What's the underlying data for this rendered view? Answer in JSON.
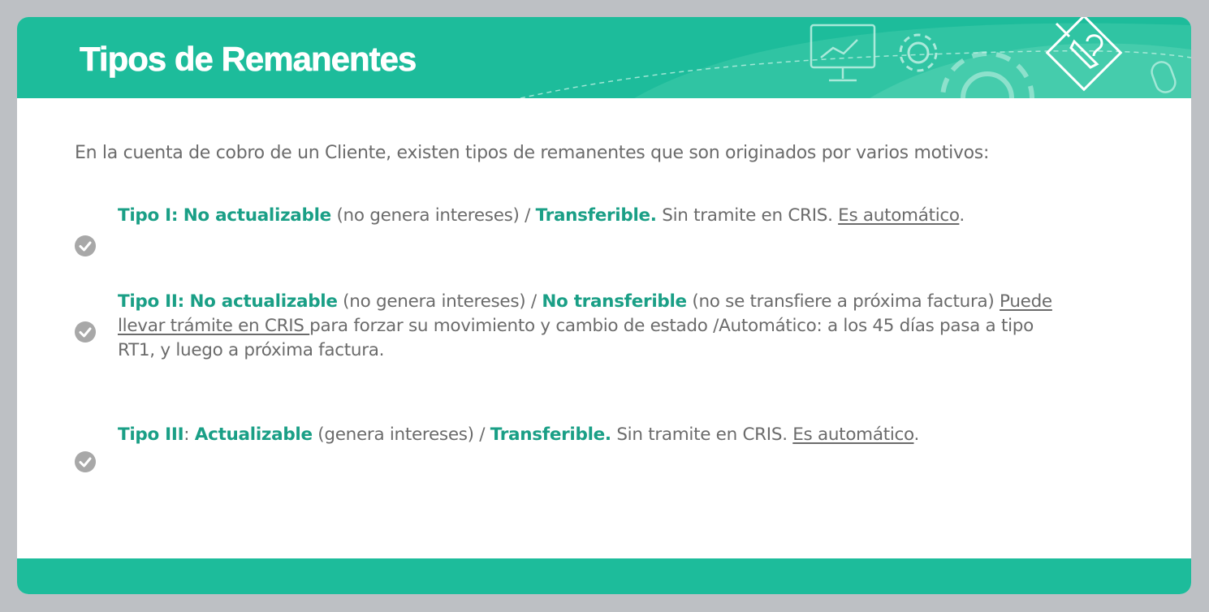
{
  "title": "Tipos de Remanentes",
  "intro": "En la cuenta de cobro de un Cliente, existen tipos de remanentes que son originados por varios motivos:",
  "colors": {
    "accent": "#1dbc9b",
    "accent_text": "#1a9f86",
    "body_text": "#6b6b6b",
    "check": "#a8a8a8"
  },
  "items": [
    {
      "icon": "check-circle-icon",
      "label": "Tipo I:",
      "status": "No actualizable",
      "note": " (no genera intereses) / ",
      "transfer": "Transferible.",
      "tail": " Sin tramite en CRIS. ",
      "underlined": "Es automático",
      "end": "."
    },
    {
      "icon": "check-circle-icon",
      "label": "Tipo II:",
      "status": "No actualizable",
      "note": " (no genera intereses) / ",
      "transfer": "No transferible",
      "note2": " (no se transfiere a próxima factura) ",
      "underlined": "Puede llevar trámite en CRIS ",
      "tail": "para forzar su movimiento y cambio de estado /Automático: a los 45 días pasa a tipo RT1, y luego a próxima factura."
    },
    {
      "icon": "check-circle-icon",
      "label": "Tipo III",
      "colon": ":",
      "status": "Actualizable",
      "note": " (genera intereses) / ",
      "transfer": "Transferible.",
      "tail": " Sin tramite en CRIS. ",
      "underlined": "Es automático",
      "end": "."
    }
  ]
}
